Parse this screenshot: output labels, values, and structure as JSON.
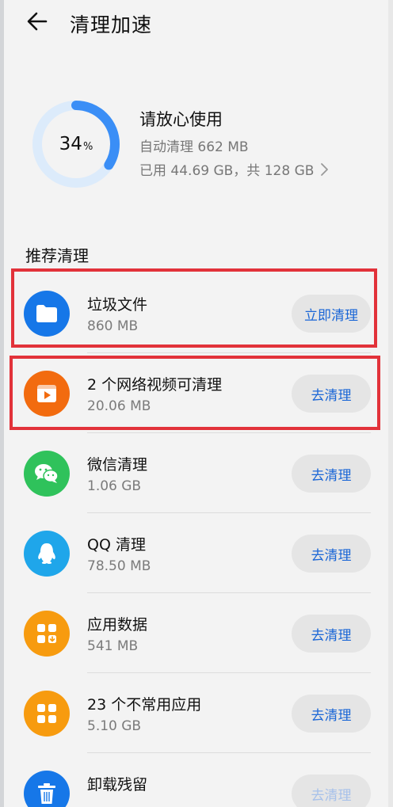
{
  "header": {
    "title": "清理加速"
  },
  "storage": {
    "percent": 34,
    "percent_text": "34",
    "percent_unit": "%",
    "status": "请放心使用",
    "auto_clean": "自动清理 662 MB",
    "used_summary": "已用 44.69 GB，共 128 GB"
  },
  "section": {
    "title": "推荐清理"
  },
  "items": [
    {
      "name": "垃圾文件",
      "size": "860 MB",
      "button": "立即清理",
      "icon": "folder-icon",
      "color": "#1677e8"
    },
    {
      "name": "2 个网络视频可清理",
      "size": "20.06 MB",
      "button": "去清理",
      "icon": "video-icon",
      "color": "#f26b0f"
    },
    {
      "name": "微信清理",
      "size": "1.06 GB",
      "button": "去清理",
      "icon": "wechat-icon",
      "color": "#2fc25b"
    },
    {
      "name": "QQ 清理",
      "size": "78.50 MB",
      "button": "去清理",
      "icon": "qq-icon",
      "color": "#1fa6ea"
    },
    {
      "name": "应用数据",
      "size": "541 MB",
      "button": "去清理",
      "icon": "app-data-icon",
      "color": "#f79b0f"
    },
    {
      "name": "23 个不常用应用",
      "size": "5.10 GB",
      "button": "去清理",
      "icon": "apps-grid-icon",
      "color": "#f79b0f"
    },
    {
      "name": "卸载残留",
      "size": "",
      "button": "去清理",
      "icon": "trash-icon",
      "color": "#1677e8"
    }
  ],
  "colors": {
    "accent": "#1a66d6",
    "ring": "#3a8ef6",
    "ring_track": "#dcebfb",
    "highlight": "#e2323a"
  }
}
